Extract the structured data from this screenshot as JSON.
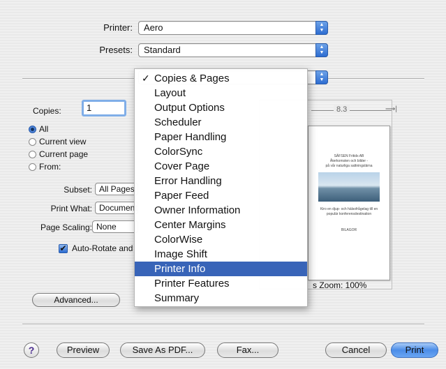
{
  "printer": {
    "label": "Printer:",
    "value": "Aero"
  },
  "presets": {
    "label": "Presets:",
    "value": "Standard"
  },
  "copies": {
    "label": "Copies:",
    "value": "1"
  },
  "range": {
    "options": [
      "All",
      "Current view",
      "Current page",
      "From:"
    ],
    "selected": "All"
  },
  "subset": {
    "label": "Subset:",
    "value": "All Pages"
  },
  "print_what": {
    "label": "Print What:",
    "value": "Document"
  },
  "page_scaling": {
    "label": "Page Scaling:",
    "value": "None"
  },
  "auto_rotate": {
    "label": "Auto-Rotate and",
    "checked": true
  },
  "advanced_button": "Advanced...",
  "preview": {
    "width_label": "8.3",
    "doc_lines": [
      "SÄFSEN Fritids AB",
      "Återkomsten och bilder -",
      "på vår naturliga sattningslärna"
    ],
    "doc_caption": [
      "Kiro en djup- och hälsofrågelag till en",
      "populär konferensdestination"
    ],
    "doc_footer": "BILAGOR",
    "units_zoom": "s Zoom: 100%"
  },
  "panel_menu": {
    "items": [
      "Copies & Pages",
      "Layout",
      "Output Options",
      "Scheduler",
      "Paper Handling",
      "ColorSync",
      "Cover Page",
      "Error Handling",
      "Paper Feed",
      "Owner Information",
      "Center Margins",
      "ColorWise",
      "Image Shift",
      "Printer Info",
      "Printer Features",
      "Summary"
    ],
    "checked": "Copies & Pages",
    "highlighted": "Printer Info"
  },
  "bottom": {
    "help": "?",
    "preview": "Preview",
    "save_pdf": "Save As PDF...",
    "fax": "Fax...",
    "cancel": "Cancel",
    "print": "Print"
  },
  "colors": {
    "menu_highlight": "#3864b8",
    "default_button": "#4b8de8"
  }
}
